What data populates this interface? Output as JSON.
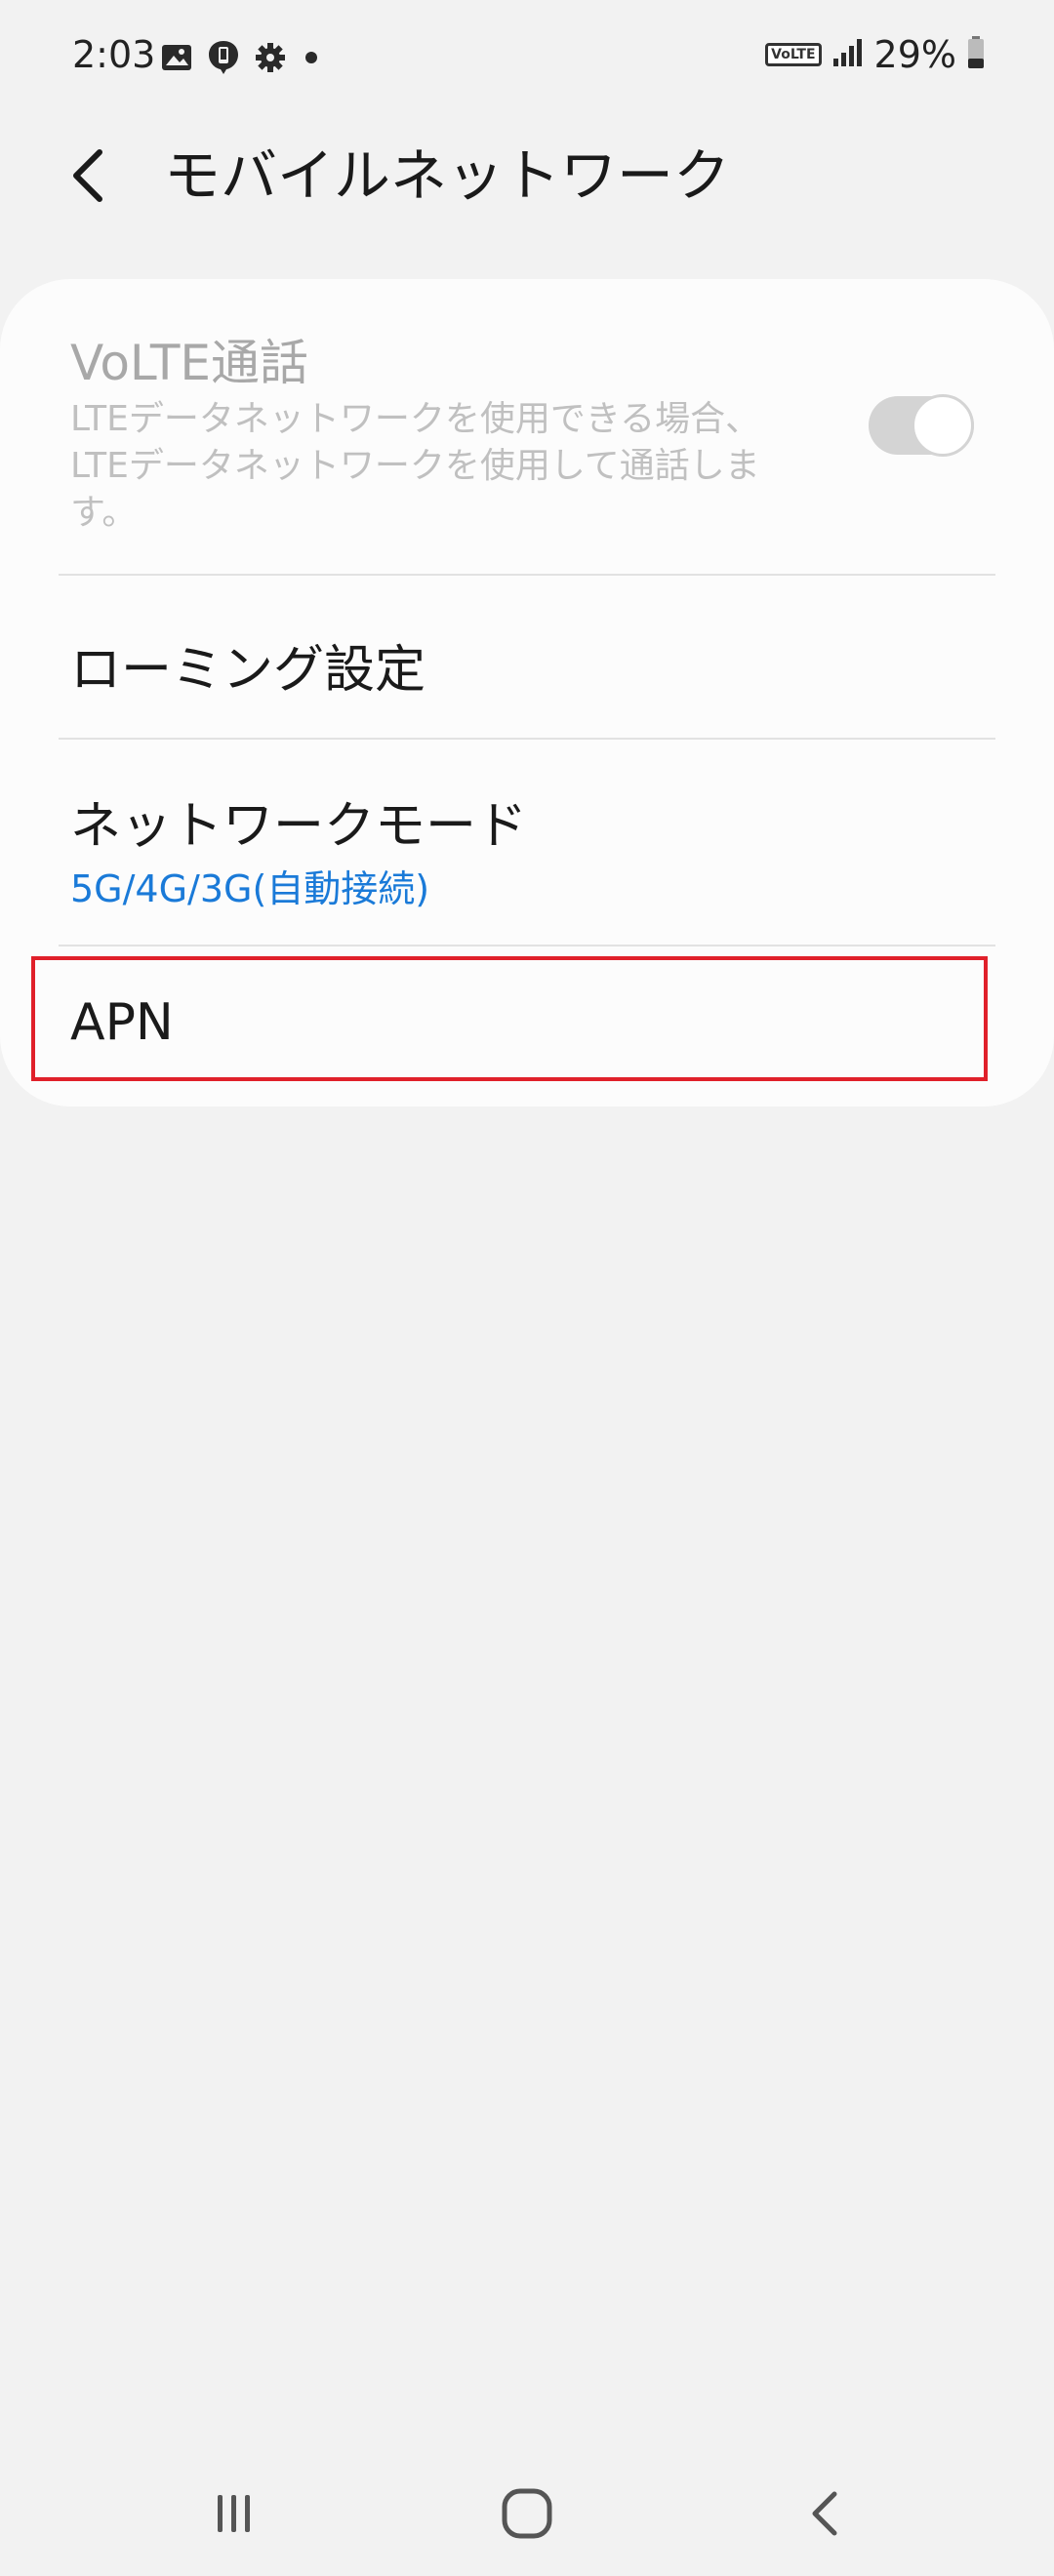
{
  "status_bar": {
    "time": "2:03",
    "volte_badge": "VoLTE",
    "battery_percent": "29%",
    "icons": [
      "image-icon",
      "message-icon",
      "gear-icon",
      "dot-icon",
      "signal-icon",
      "battery-icon"
    ]
  },
  "header": {
    "title": "モバイルネットワーク",
    "back_icon": "chevron-left-icon"
  },
  "settings": {
    "volte": {
      "title": "VoLTE通話",
      "description": "LTEデータネットワークを使用できる場合、LTEデータネットワークを使用して通話します。",
      "enabled": true,
      "toggle_state": "disabled-on"
    },
    "roaming": {
      "label": "ローミング設定"
    },
    "network_mode": {
      "label": "ネットワークモード",
      "value": "5G/4G/3G(自動接続)"
    },
    "apn": {
      "label": "APN",
      "highlighted": true
    }
  },
  "colors": {
    "background": "#f2f2f2",
    "card": "#fcfcfc",
    "accent": "#1a7ad8",
    "highlight": "#e0202a",
    "disabled_text": "#a8a8a8"
  },
  "nav_bar": {
    "buttons": [
      "recents-icon",
      "home-icon",
      "back-icon"
    ]
  }
}
